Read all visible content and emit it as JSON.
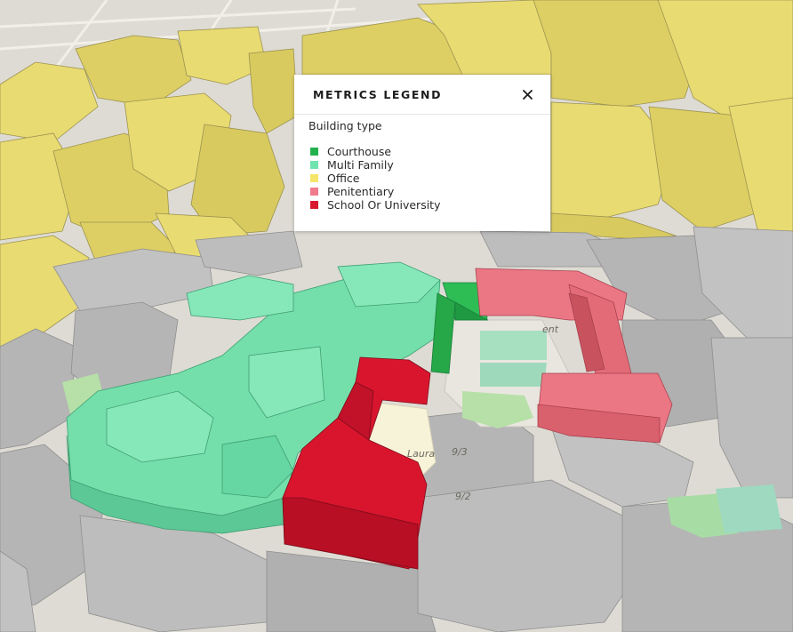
{
  "legend": {
    "title": "METRICS LEGEND",
    "close_icon": "close-icon",
    "subtitle": "Building type",
    "items": [
      {
        "label": "Courthouse",
        "color": "#22b14c"
      },
      {
        "label": "Multi Family",
        "color": "#6fe3b0"
      },
      {
        "label": "Office",
        "color": "#f5e56b"
      },
      {
        "label": "Penitentiary",
        "color": "#f07c8b"
      },
      {
        "label": "School Or University",
        "color": "#d7182f"
      }
    ]
  },
  "map": {
    "colors": {
      "courthouse": "#2ebd55",
      "multi_family": "#74dfaa",
      "office": "#e8db72",
      "penitentiary": "#ec7784",
      "school_or_university": "#d9152e",
      "other": "#b5b5b5",
      "ground": "#e3e0da",
      "park": "#a8dca5"
    },
    "street_labels": [
      "Laura",
      "9/3",
      "9/2",
      "ent"
    ]
  }
}
